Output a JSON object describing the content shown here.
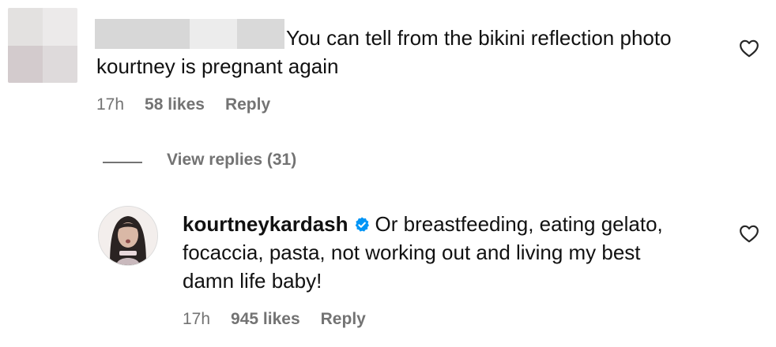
{
  "comment": {
    "text": "You can tell from the bikini reflection photo kourtney is pregnant again",
    "time": "17h",
    "likes": "58 likes",
    "reply": "Reply"
  },
  "thread": {
    "view_replies": "View replies (31)"
  },
  "reply_comment": {
    "username": "kourtneykardash",
    "text": "Or breastfeeding, eating gelato, focaccia, pasta, not working out and living my best damn life baby!",
    "time": "17h",
    "likes": "945 likes",
    "reply": "Reply"
  },
  "icons": {
    "like": "heart-outline-icon",
    "verified": "verified-badge-icon",
    "verified_color": "#0095f6"
  }
}
